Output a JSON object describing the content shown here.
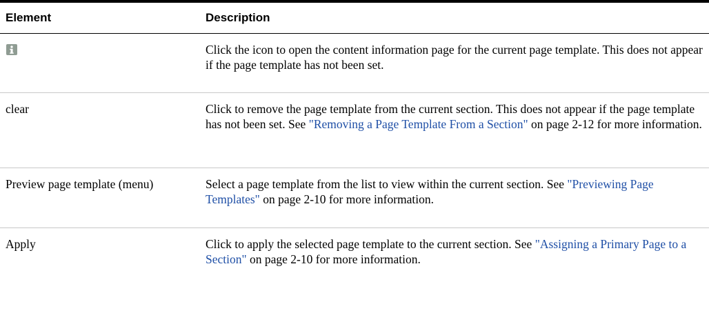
{
  "colors": {
    "link": "#1f4fa6",
    "icon_fill": "#8f9c93"
  },
  "table": {
    "headers": {
      "element": "Element",
      "description": "Description"
    },
    "rows": [
      {
        "element_icon": "info-icon",
        "description": "Click the icon to open the content information page for the current page template. This does not appear if the page template has not been set."
      },
      {
        "element": "clear",
        "description_before": "Click to remove the page template from the current section. This does not appear if the page template has not been set. See ",
        "link": "\"Removing a Page Template From a Section\"",
        "description_after": " on page 2-12 for more information."
      },
      {
        "element": "Preview page template (menu)",
        "description_before": "Select a page template from the list to view within the current section. See ",
        "link": "\"Previewing Page Templates\"",
        "description_after": " on page 2-10 for more information."
      },
      {
        "element": "Apply",
        "description_before": "Click to apply the selected page template to the current section. See ",
        "link": "\"Assigning a Primary Page to a Section\"",
        "description_after": " on page 2-10 for more information."
      }
    ]
  }
}
